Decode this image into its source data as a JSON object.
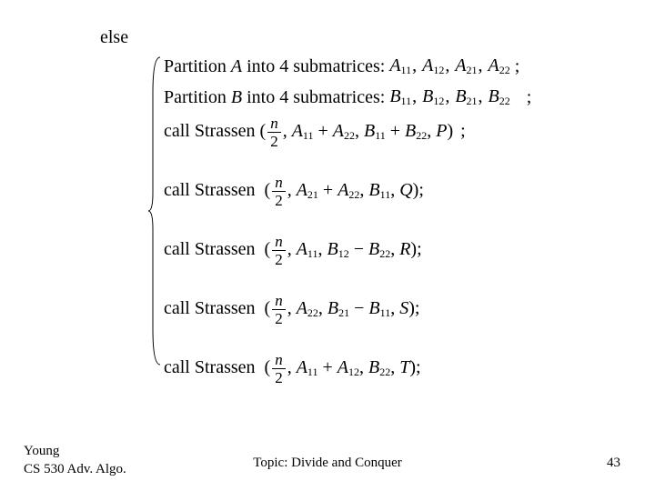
{
  "else_kw": "else",
  "partA": "Partition ",
  "A": "A",
  "partA2": " into 4 submatrices: ",
  "A11": "A",
  "s11": "11",
  "A12": "A",
  "s12": "12",
  "A21": "A",
  "s21": "21",
  "A22": "A",
  "s22": "22",
  "partB": "Partition ",
  "B": "B",
  "partB2": " into 4 submatrices: ",
  "B11": "B",
  "bs11": "11",
  "B12": "B",
  "bs12": "12",
  "B21": "B",
  "bs21": "21",
  "B22": "B",
  "bs22": "22",
  "call": "call Strassen",
  "call0": "call Strassen (",
  "n": "n",
  "two": "2",
  "semi": ";",
  "comma": ",",
  "lp": "(",
  "rp": ")",
  "plus": " + ",
  "minus": " − ",
  "P": "P",
  "Q": "Q",
  "R": "R",
  "S": "S",
  "T": "T",
  "c1_a": "A",
  "c1_as": "11",
  "c1_b": "A",
  "c1_bs": "22",
  "c1_c": "B",
  "c1_cs": "11",
  "c1_d": "B",
  "c1_ds": "22",
  "c2_a": "A",
  "c2_as": "21",
  "c2_b": "A",
  "c2_bs": "22",
  "c2_c": "B",
  "c2_cs": "11",
  "c3_a": "A",
  "c3_as": "11",
  "c3_b": "B",
  "c3_bs": "12",
  "c3_c": "B",
  "c3_cs": "22",
  "c4_a": "A",
  "c4_as": "22",
  "c4_b": "B",
  "c4_bs": "21",
  "c4_c": "B",
  "c4_cs": "11",
  "c5_a": "A",
  "c5_as": "11",
  "c5_b": "A",
  "c5_bs": "12",
  "c5_c": "B",
  "c5_cs": "22",
  "footer": {
    "author": "Young",
    "course": "CS 530 Adv. Algo.",
    "topic": "Topic: Divide and Conquer",
    "page": "43"
  }
}
